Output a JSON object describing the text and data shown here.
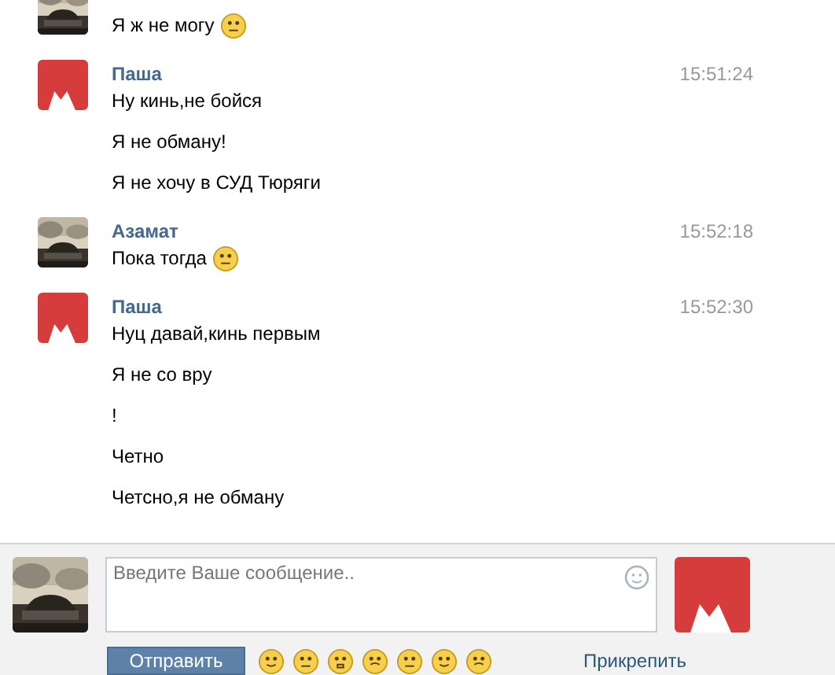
{
  "messages": [
    {
      "kind": "car",
      "messages": [
        {
          "text": "Я ж не могу",
          "emoji": true
        }
      ]
    },
    {
      "kind": "cat",
      "author": "Паша",
      "time": "15:51:24",
      "messages": [
        {
          "text": "Ну кинь,не бойся",
          "emoji": false
        },
        {
          "text": "Я не обману!",
          "emoji": false
        },
        {
          "text": "Я не хочу в СУД Тюряги",
          "emoji": false
        }
      ]
    },
    {
      "kind": "car",
      "author": "Азамат",
      "time": "15:52:18",
      "messages": [
        {
          "text": "Пока тогда",
          "emoji": true
        }
      ]
    },
    {
      "kind": "cat",
      "author": "Паша",
      "time": "15:52:30",
      "messages": [
        {
          "text": "Нуц давай,кинь первым",
          "emoji": false
        },
        {
          "text": "Я не со вру",
          "emoji": false
        },
        {
          "text": "!",
          "emoji": false
        },
        {
          "text": "Четно",
          "emoji": false
        },
        {
          "text": "Четсно,я не обману",
          "emoji": false
        }
      ]
    }
  ],
  "composer": {
    "placeholder": "Введите Ваше сообщение..",
    "send": "Отправить",
    "attach": "Прикрепить"
  }
}
